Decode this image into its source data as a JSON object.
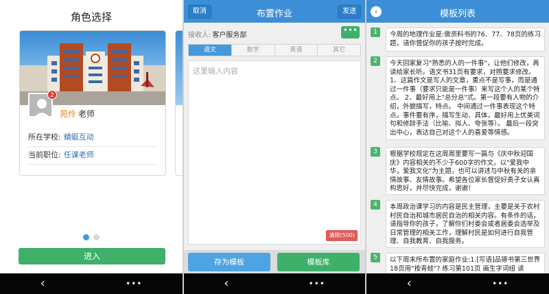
{
  "screen1": {
    "title": "角色选择",
    "badge_count": "2",
    "user_name": "苑伶",
    "user_role": "老师",
    "school_label": "所在学校:",
    "school_value": "蜻蜓互动",
    "position_label": "当前职位:",
    "position_value": "任课老师",
    "enter_button": "进入",
    "page_dots": {
      "count": 2,
      "active_index": 0
    }
  },
  "screen2": {
    "cancel_button": "取消",
    "title": "布置作业",
    "send_button": "发送",
    "receiver_label": "接收人:",
    "receiver_value": "客户服务部",
    "more_button": "•••",
    "tabs": [
      "语文",
      "数学",
      "英语",
      "其它"
    ],
    "active_tab": "语文",
    "editor_placeholder": "这里输入内容",
    "clear_button": "清除(500)",
    "save_template_button": "存为模板",
    "template_library_button": "模板库"
  },
  "screen3": {
    "back_icon": "back-circle-icon",
    "title": "模板列表",
    "items": [
      {
        "num": "1",
        "text": "今周的地理作业是:做资料书的76、77、78页的练习题，请你督促你的孩子按时完成。"
      },
      {
        "num": "2",
        "text": "今天回家复习\"熟悉的人的一件事\"，让他们修改，再读给家长听。语文书31页有要求，对照要求修改。 1、这篇作文是写人的文章，重点不是写事，而是通过一件事（要求只能是一件事）来写这个人的某个特点。 2、最好用上\"总分总\"式。第一段要有人物的介绍，外貌描写，特点。 中间通过一件事表现这个特点。事件要有序，描写生动、具体，最好用上优美词句和修辞手法（比喻、拟人、夸张等）。 最后一段突出中心，表达自己对这个人的喜爱等情感。"
      },
      {
        "num": "3",
        "text": "根据学校规定在这周周里要写一篇与《庆中秋迎国庆》内容相关的不少于600字的作文。以\"爱我中华，爱我文化\"为主题，也可以讲述与中秋有关的亲情故事、友情故事。希望各位家长督促好贵子女认真构思好，并尽快完成，谢谢！"
      },
      {
        "num": "4",
        "text": "本周政治课学习的内容是民主管理，主要是关于农村村民自治和城市居民自治的相关内容。有条件的话，请指导你的孩子，了解你们村委会或者居委会选举及日常管理的相关工作，理解村民是如何进行自我管理、自我教育、自我服务。"
      },
      {
        "num": "5",
        "text": "以下周末所布置的家庭作业:1.[写语]品德书第三世界18页用\"按青蛙\"? 练习第101页 画生字词组 读"
      }
    ]
  },
  "nav": {
    "back_glyph": "‹",
    "menu_glyph": "•••"
  },
  "colors": {
    "primary_blue": "#3c8fd6",
    "green": "#3eb06a",
    "red": "#e05a5a",
    "name_orange": "#e08a1e"
  }
}
